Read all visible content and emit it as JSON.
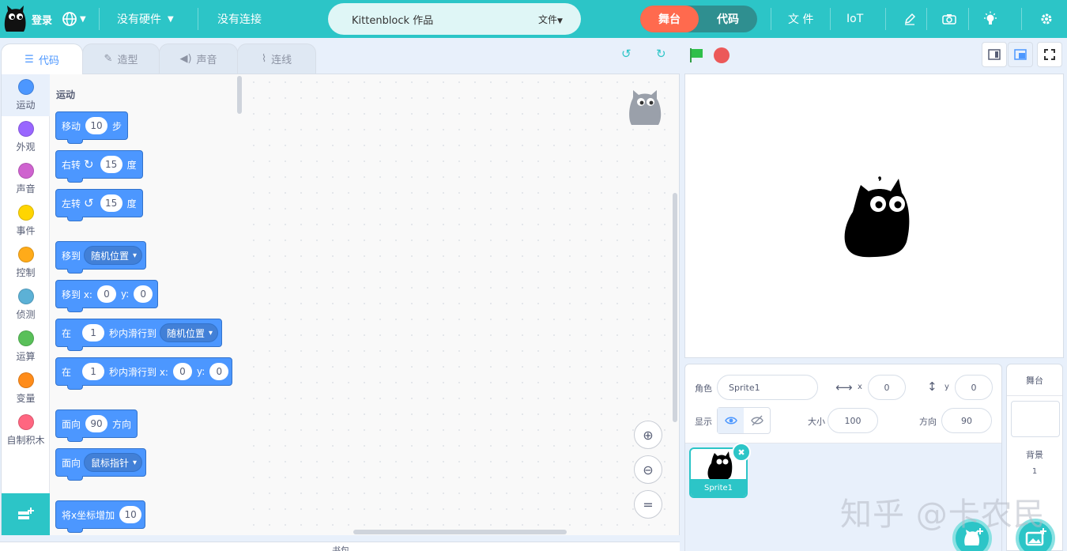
{
  "menubar": {
    "login": "登录",
    "hardware": "没有硬件",
    "connection": "没有连接",
    "project_title": "Kittenblock 作品",
    "file_menu": "文件",
    "mode_stage": "舞台",
    "mode_code": "代码",
    "file": "文 件",
    "iot": "IoT"
  },
  "tabs": [
    {
      "label": "代码",
      "icon": "code-icon"
    },
    {
      "label": "造型",
      "icon": "brush-icon"
    },
    {
      "label": "声音",
      "icon": "speaker-icon"
    },
    {
      "label": "连线",
      "icon": "wire-icon"
    }
  ],
  "categories": [
    {
      "label": "运动",
      "color": "#4c97ff"
    },
    {
      "label": "外观",
      "color": "#9966ff"
    },
    {
      "label": "声音",
      "color": "#cf63cf"
    },
    {
      "label": "事件",
      "color": "#ffd500"
    },
    {
      "label": "控制",
      "color": "#ffab19"
    },
    {
      "label": "侦测",
      "color": "#5cb1d6"
    },
    {
      "label": "运算",
      "color": "#59c059"
    },
    {
      "label": "变量",
      "color": "#ff8c1a"
    },
    {
      "label": "自制积木",
      "color": "#ff6680"
    }
  ],
  "flyout": {
    "title": "运动",
    "blocks": {
      "move": {
        "label": "移动",
        "value": "10",
        "unit": "步"
      },
      "turn_right": {
        "label": "右转",
        "value": "15",
        "unit": "度"
      },
      "turn_left": {
        "label": "左转",
        "value": "15",
        "unit": "度"
      },
      "goto": {
        "label": "移到",
        "option": "随机位置"
      },
      "goto_xy": {
        "label": "移到 x:",
        "x": "0",
        "ylabel": "y:",
        "y": "0"
      },
      "glide": {
        "label": "在",
        "value": "1",
        "mid": "秒内滑行到",
        "option": "随机位置"
      },
      "glide_xy": {
        "label": "在",
        "value": "1",
        "mid": "秒内滑行到 x:",
        "x": "0",
        "ylabel": "y:",
        "y": "0"
      },
      "point_dir": {
        "label": "面向",
        "value": "90",
        "unit": "方向"
      },
      "point_towards": {
        "label": "面向",
        "option": "鼠标指针"
      },
      "change_x": {
        "label": "将x坐标增加",
        "value": "10"
      }
    }
  },
  "bottom_strip": "书包",
  "sprite_info": {
    "sprite_label": "角色",
    "sprite_name": "Sprite1",
    "x_label": "x",
    "x_value": "0",
    "y_label": "y",
    "y_value": "0",
    "show_label": "显示",
    "size_label": "大小",
    "size_value": "100",
    "direction_label": "方向",
    "direction_value": "90"
  },
  "sprites": [
    {
      "name": "Sprite1"
    }
  ],
  "stage_panel": {
    "title": "舞台",
    "backdrop_label": "背景",
    "backdrop_count": "1"
  },
  "watermark": "知乎 @卡农民"
}
